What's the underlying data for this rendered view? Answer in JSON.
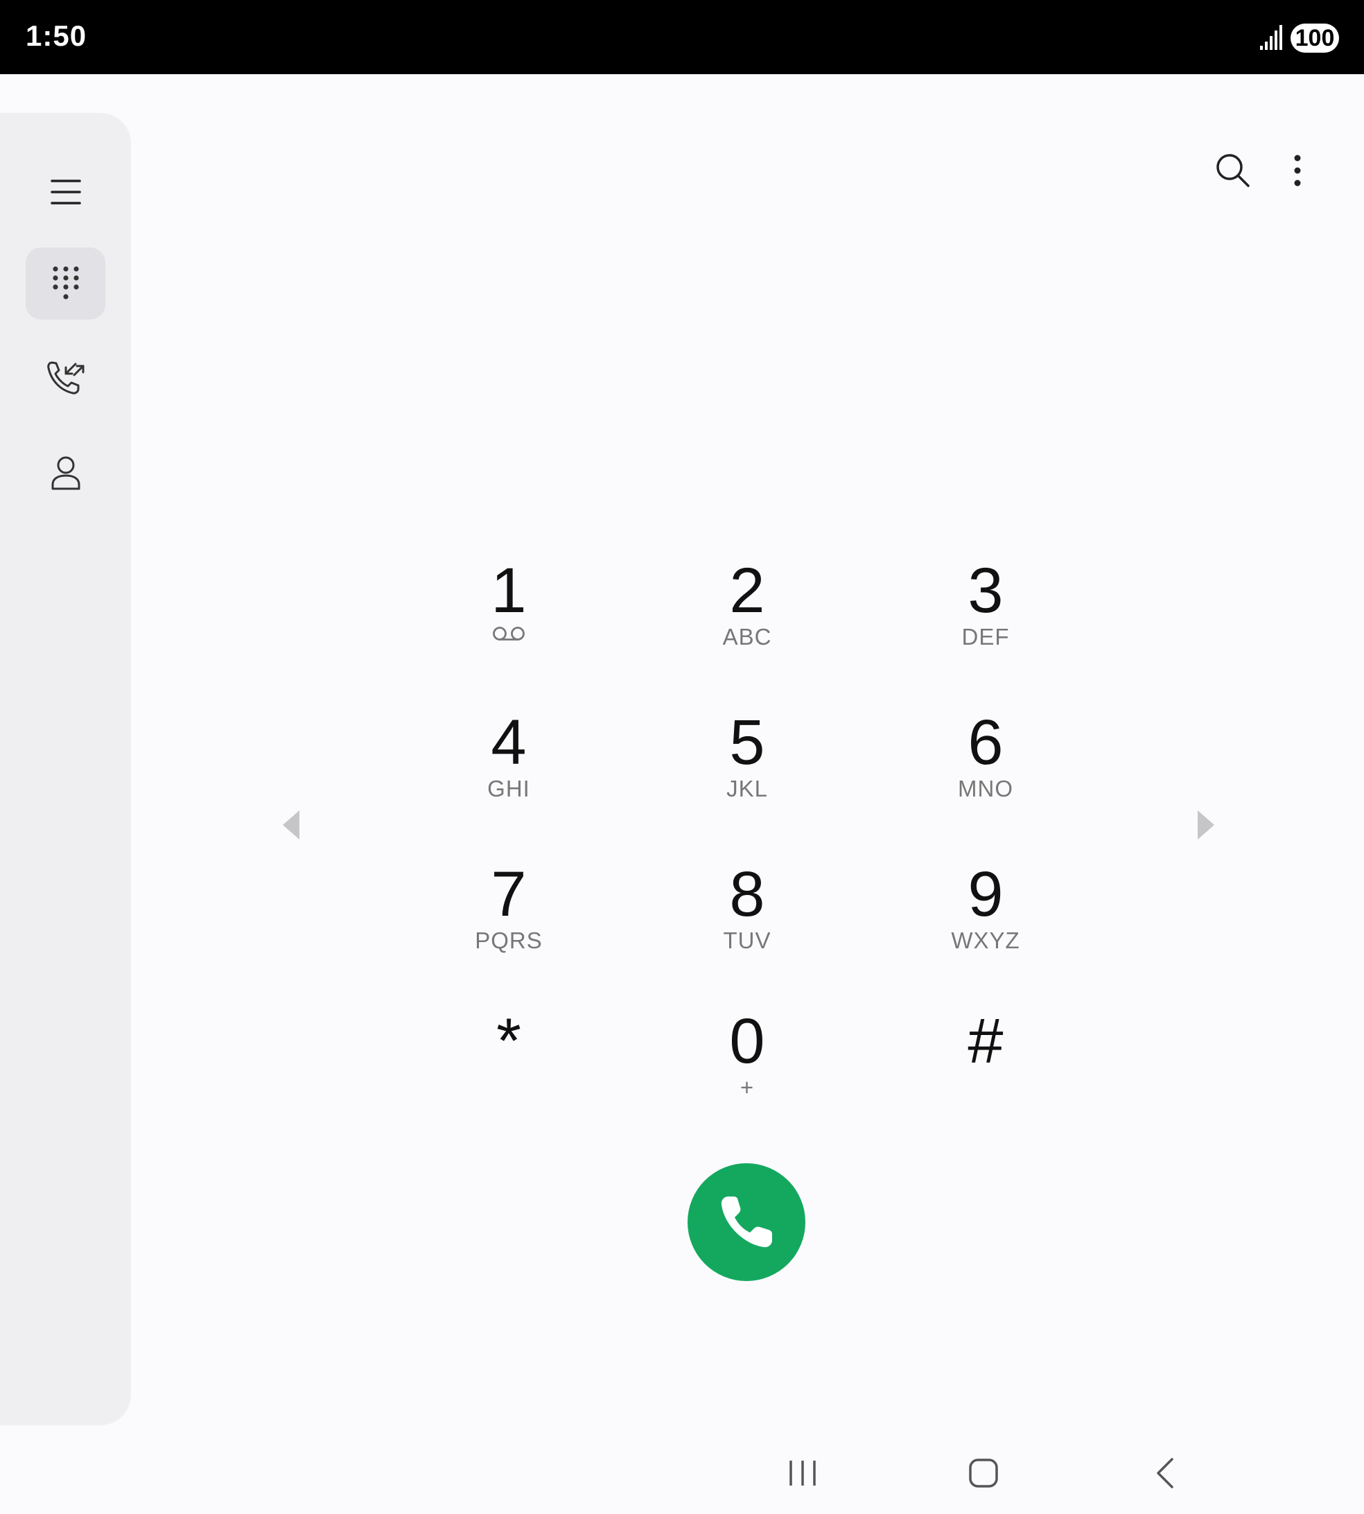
{
  "status_bar": {
    "time": "1:50",
    "battery": "100"
  },
  "nav_rail": {
    "items": [
      {
        "name": "menu",
        "icon": "hamburger-menu-icon"
      },
      {
        "name": "keypad",
        "icon": "dialpad-icon",
        "active": true
      },
      {
        "name": "recents",
        "icon": "call-log-icon"
      },
      {
        "name": "contacts",
        "icon": "contact-person-icon"
      }
    ]
  },
  "top_actions": {
    "search_icon": "search-icon",
    "more_icon": "more-vert-icon"
  },
  "keypad": {
    "keys": [
      {
        "digit": "1",
        "letters": "",
        "sub_icon": "voicemail-icon"
      },
      {
        "digit": "2",
        "letters": "ABC"
      },
      {
        "digit": "3",
        "letters": "DEF"
      },
      {
        "digit": "4",
        "letters": "GHI"
      },
      {
        "digit": "5",
        "letters": "JKL"
      },
      {
        "digit": "6",
        "letters": "MNO"
      },
      {
        "digit": "7",
        "letters": "PQRS"
      },
      {
        "digit": "8",
        "letters": "TUV"
      },
      {
        "digit": "9",
        "letters": "WXYZ"
      },
      {
        "digit": "*",
        "letters": ""
      },
      {
        "digit": "0",
        "letters": "+"
      },
      {
        "digit": "#",
        "letters": ""
      }
    ]
  },
  "call_button": {
    "icon": "phone-icon",
    "color": "#14a85f"
  },
  "system_nav": {
    "recents_icon": "recent-apps-icon",
    "home_icon": "home-icon",
    "back_icon": "back-icon"
  }
}
